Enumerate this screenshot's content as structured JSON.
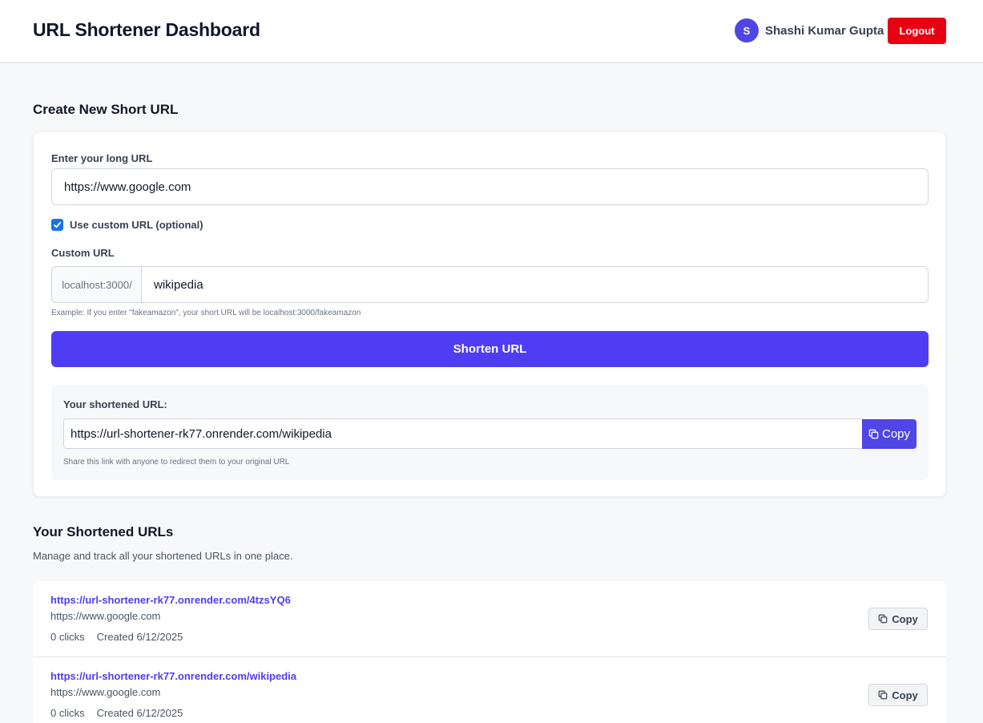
{
  "header": {
    "title": "URL Shortener Dashboard",
    "avatar_initial": "S",
    "user_name": "Shashi Kumar Gupta",
    "logout_label": "Logout"
  },
  "create": {
    "section_title": "Create New Short URL",
    "long_url_label": "Enter your long URL",
    "long_url_value": "https://www.google.com",
    "custom_checkbox_label": "Use custom URL (optional)",
    "custom_checked": true,
    "custom_url_label": "Custom URL",
    "custom_prefix": "localhost:3000/",
    "custom_value": "wikipedia",
    "example_hint": "Example: If you enter \"fakeamazon\", your short URL will be localhost:3000/fakeamazon",
    "shorten_label": "Shorten URL",
    "result_label": "Your shortened URL:",
    "result_value": "https://url-shortener-rk77.onrender.com/wikipedia",
    "result_copy_label": "Copy",
    "result_hint": "Share this link with anyone to redirect them to your original URL"
  },
  "list": {
    "section_title": "Your Shortened URLs",
    "subtitle": "Manage and track all your shortened URLs in one place.",
    "items": [
      {
        "short_url": "https://url-shortener-rk77.onrender.com/4tzsYQ6",
        "original_url": "https://www.google.com",
        "clicks": "0 clicks",
        "created": "Created 6/12/2025",
        "copy_label": "Copy"
      },
      {
        "short_url": "https://url-shortener-rk77.onrender.com/wikipedia",
        "original_url": "https://www.google.com",
        "clicks": "0 clicks",
        "created": "Created 6/12/2025",
        "copy_label": "Copy"
      }
    ]
  },
  "colors": {
    "primary": "#4f3df4",
    "logout": "#e60012",
    "checkbox": "#1a73e8"
  },
  "icons": [
    "check-icon",
    "copy-icon"
  ]
}
